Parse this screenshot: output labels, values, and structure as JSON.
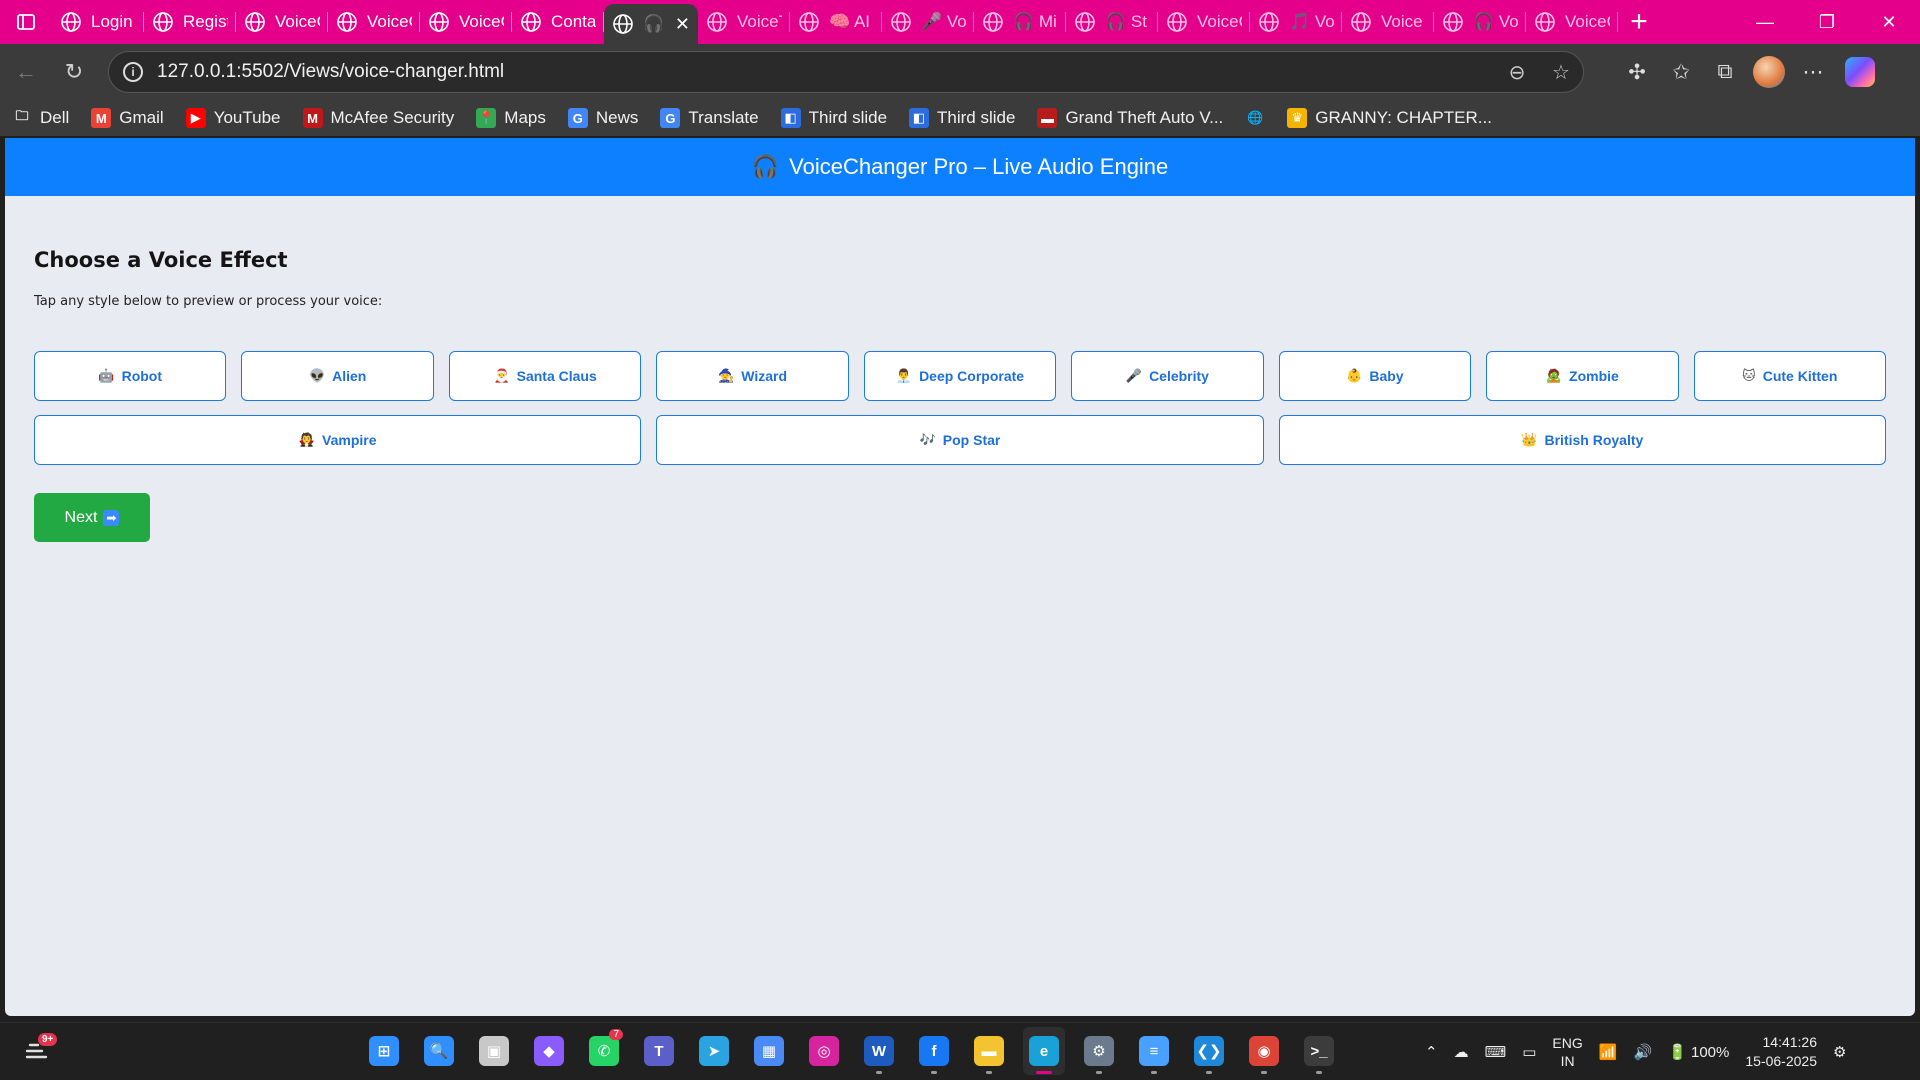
{
  "browser": {
    "tabs": [
      {
        "title": "",
        "icon": "tab-actions-icon"
      },
      {
        "title": "Login",
        "icon": "globe-icon"
      },
      {
        "title": "Regist",
        "icon": "globe-icon"
      },
      {
        "title": "VoiceC",
        "icon": "globe-icon"
      },
      {
        "title": "VoiceC",
        "icon": "globe-icon"
      },
      {
        "title": "VoiceC",
        "icon": "globe-icon"
      },
      {
        "title": "Conta",
        "icon": "globe-icon"
      },
      {
        "title": "🎧",
        "icon": "globe-icon",
        "active": true
      },
      {
        "title": "VoiceT",
        "icon": "globe-icon"
      },
      {
        "title": "🧠 AI",
        "icon": "globe-icon"
      },
      {
        "title": "🎤 Vo",
        "icon": "globe-icon"
      },
      {
        "title": "🎧 Mi",
        "icon": "globe-icon"
      },
      {
        "title": "🎧 St",
        "icon": "globe-icon"
      },
      {
        "title": "VoiceC",
        "icon": "globe-icon"
      },
      {
        "title": "🎵 Vo",
        "icon": "globe-icon"
      },
      {
        "title": "Voice",
        "icon": "globe-icon"
      },
      {
        "title": "🎧 Vo",
        "icon": "globe-icon"
      },
      {
        "title": "VoiceC",
        "icon": "globe-icon"
      }
    ],
    "url": "127.0.0.1:5502/Views/voice-changer.html",
    "bookmarks": [
      {
        "label": "Dell",
        "icon": "folder-icon",
        "color": "#3b3b3b"
      },
      {
        "label": "Gmail",
        "icon": "gmail-icon",
        "color": "#ea4335"
      },
      {
        "label": "YouTube",
        "icon": "youtube-icon",
        "color": "#ff0000"
      },
      {
        "label": "McAfee Security",
        "icon": "mcafee-icon",
        "color": "#c01818"
      },
      {
        "label": "Maps",
        "icon": "maps-icon",
        "color": "#34a853"
      },
      {
        "label": "News",
        "icon": "news-icon",
        "color": "#4285f4"
      },
      {
        "label": "Translate",
        "icon": "translate-icon",
        "color": "#4285f4"
      },
      {
        "label": "Third slide",
        "icon": "slide-icon",
        "color": "#2d6cdf"
      },
      {
        "label": "Third slide",
        "icon": "slide-icon",
        "color": "#2d6cdf"
      },
      {
        "label": "Grand Theft Auto V...",
        "icon": "gta-icon",
        "color": "#b71c1c"
      },
      {
        "label": "",
        "icon": "globe-icon",
        "color": "#3b3b3b"
      },
      {
        "label": "GRANNY: CHAPTER...",
        "icon": "crown-icon",
        "color": "#f5b400"
      }
    ]
  },
  "page": {
    "header_icon": "🎧",
    "header_title": "VoiceChanger Pro – Live Audio Engine",
    "heading": "Choose a Voice Effect",
    "subtitle": "Tap any style below to preview or process your voice:",
    "effects_row1": [
      {
        "emoji": "🤖",
        "label": "Robot"
      },
      {
        "emoji": "👽",
        "label": "Alien"
      },
      {
        "emoji": "🎅",
        "label": "Santa Claus"
      },
      {
        "emoji": "🧙",
        "label": "Wizard"
      },
      {
        "emoji": "👨‍💼",
        "label": "Deep Corporate"
      },
      {
        "emoji": "🎤",
        "label": "Celebrity"
      },
      {
        "emoji": "👶",
        "label": "Baby"
      },
      {
        "emoji": "🧟",
        "label": "Zombie"
      },
      {
        "emoji": "🐱",
        "label": "Cute Kitten"
      }
    ],
    "effects_row2": [
      {
        "emoji": "🧛",
        "label": "Vampire"
      },
      {
        "emoji": "🎶",
        "label": "Pop Star"
      },
      {
        "emoji": "👑",
        "label": "British Royalty"
      }
    ],
    "next_label": "Next",
    "next_arrow": "➡"
  },
  "taskbar": {
    "weather_badge": "9+",
    "apps": [
      {
        "name": "start",
        "color": "#2f8fff",
        "glyph": "⊞"
      },
      {
        "name": "search",
        "color": "#2f8fff",
        "glyph": "🔍"
      },
      {
        "name": "task-view",
        "color": "#c8c8c8",
        "glyph": "▣"
      },
      {
        "name": "copilot",
        "color": "#8a5cff",
        "glyph": "◆"
      },
      {
        "name": "whatsapp",
        "color": "#25d366",
        "glyph": "✆",
        "badge": "7"
      },
      {
        "name": "teams",
        "color": "#5b5fc7",
        "glyph": "T"
      },
      {
        "name": "telegram",
        "color": "#2aa3e0",
        "glyph": "➤"
      },
      {
        "name": "store",
        "color": "#4a8af4",
        "glyph": "▦"
      },
      {
        "name": "instagram",
        "color": "#d6249f",
        "glyph": "◎"
      },
      {
        "name": "word",
        "color": "#1e5bbf",
        "glyph": "W"
      },
      {
        "name": "facebook",
        "color": "#1877f2",
        "glyph": "f"
      },
      {
        "name": "file-explorer",
        "color": "#f4c430",
        "glyph": "▬"
      },
      {
        "name": "edge",
        "color": "#1aa1d8",
        "glyph": "e",
        "active": true
      },
      {
        "name": "settings",
        "color": "#6b7a8c",
        "glyph": "⚙"
      },
      {
        "name": "notepad",
        "color": "#4aa0ff",
        "glyph": "≡"
      },
      {
        "name": "vscode",
        "color": "#1f88d8",
        "glyph": "❮❯"
      },
      {
        "name": "chrome",
        "color": "#db4437",
        "glyph": "◉"
      },
      {
        "name": "terminal",
        "color": "#3c3c3c",
        "glyph": ">_"
      }
    ],
    "language": "ENG",
    "region": "IN",
    "battery": "100%",
    "time": "14:41:26",
    "date": "15-06-2025"
  }
}
